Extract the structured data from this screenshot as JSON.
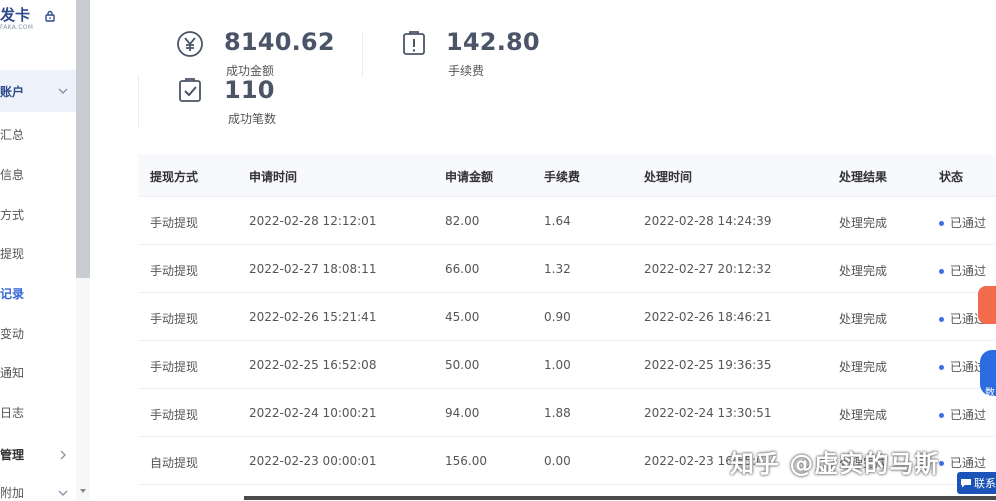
{
  "sidebar": {
    "brand_title": "发卡",
    "brand_sub": "FAKA.COM",
    "group_label": "账户",
    "items": [
      {
        "label": "汇总"
      },
      {
        "label": "信息"
      },
      {
        "label": "方式"
      },
      {
        "label": "提现"
      },
      {
        "label": "记录"
      },
      {
        "label": "变动"
      },
      {
        "label": "通知"
      },
      {
        "label": "日志"
      }
    ],
    "group2_label": "管理",
    "group3_label": "附加"
  },
  "stats": {
    "success_amount": {
      "value": "8140.62",
      "label": "成功金额"
    },
    "fee": {
      "value": "142.80",
      "label": "手续费"
    },
    "success_count": {
      "value": "110",
      "label": "成功笔数"
    }
  },
  "table": {
    "headers": [
      "提现方式",
      "申请时间",
      "申请金额",
      "手续费",
      "处理时间",
      "处理结果",
      "状态"
    ],
    "rows": [
      [
        "手动提现",
        "2022-02-28 12:12:01",
        "82.00",
        "1.64",
        "2022-02-28 14:24:39",
        "处理完成",
        "已通过"
      ],
      [
        "手动提现",
        "2022-02-27 18:08:11",
        "66.00",
        "1.32",
        "2022-02-27 20:12:32",
        "处理完成",
        "已通过"
      ],
      [
        "手动提现",
        "2022-02-26 15:21:41",
        "45.00",
        "0.90",
        "2022-02-26 18:46:21",
        "处理完成",
        "已通过"
      ],
      [
        "手动提现",
        "2022-02-25 16:52:08",
        "50.00",
        "1.00",
        "2022-02-25 19:36:35",
        "处理完成",
        "已通过"
      ],
      [
        "手动提现",
        "2022-02-24 10:00:21",
        "94.00",
        "1.88",
        "2022-02-24 13:30:51",
        "处理完成",
        "已通过"
      ],
      [
        "自动提现",
        "2022-02-23 00:00:01",
        "156.00",
        "0.00",
        "2022-02-23 16:55:01",
        "处理完成",
        "已通过"
      ]
    ]
  },
  "colors": {
    "status_dot": "#3a6fe0",
    "accent": "#3566d6"
  },
  "widgets": {
    "float_label": "数",
    "contact_label": "联系"
  },
  "watermark": "知乎 @虚实的马斯"
}
